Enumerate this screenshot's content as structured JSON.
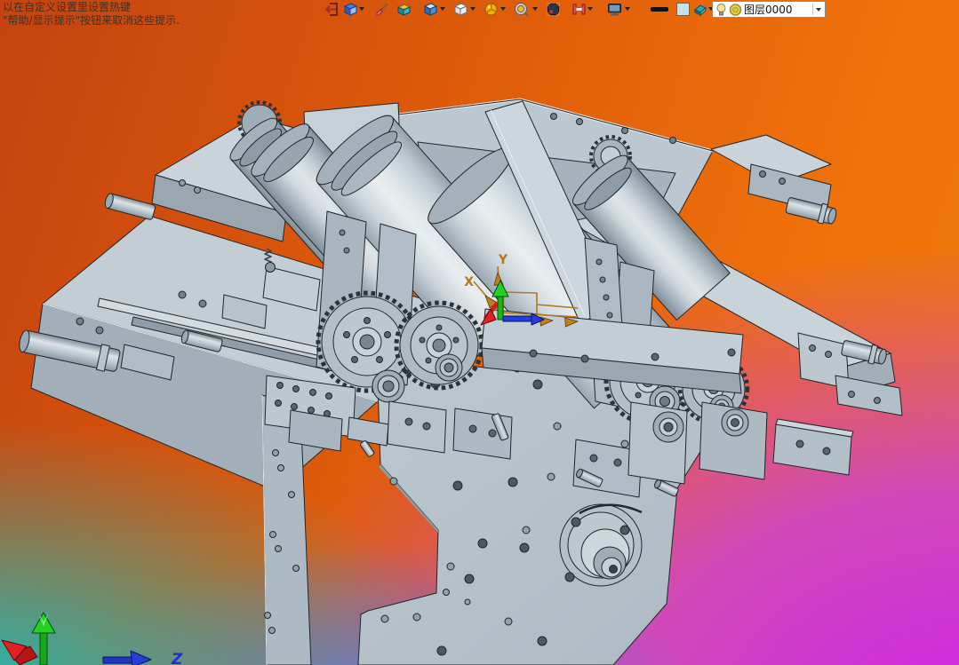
{
  "viewport": {
    "hint_line1": "以在自定义设置里设置热键",
    "hint_line2": "\"帮助/显示提示\"按钮来取消这些提示."
  },
  "toolbar": {
    "items": [
      {
        "name": "exit-icon"
      },
      {
        "name": "component-icon",
        "dropdown": true
      },
      {
        "name": "brush-icon"
      },
      {
        "name": "material-box-icon"
      },
      {
        "name": "cube-blue-icon",
        "dropdown": true
      },
      {
        "name": "cube-white-icon",
        "dropdown": true
      },
      {
        "name": "render-sphere-icon",
        "dropdown": true
      },
      {
        "name": "zoom-preview-icon",
        "dropdown": true
      },
      {
        "name": "capture-frame-icon"
      },
      {
        "name": "endpoint-constraint-icon",
        "dropdown": true
      },
      {
        "name": "display-mode-icon",
        "dropdown": true
      },
      {
        "name": "line-width-icon"
      },
      {
        "name": "color-swatch-icon"
      },
      {
        "name": "eraser-icon",
        "dropdown": true
      }
    ],
    "layer_combo": {
      "value": "图层0000",
      "bulb_icon": "visibility-bulb",
      "ring_icon": "layer-color-ring"
    }
  },
  "axes": {
    "work_x": "X",
    "work_y": "Y",
    "corner_z": "Z"
  },
  "colors": {
    "bg_top_left": "#c44310",
    "bg_top_right": "#f1790a",
    "bg_bottom_left": "#2cb3ab",
    "bg_bottom_center": "#5f74e6",
    "bg_bottom_right": "#ce25e8",
    "machine_light": "#dde4e8",
    "machine_mid": "#b7c2ca",
    "machine_dark": "#8d9ba5",
    "outline": "#20262b",
    "axis_x_red": "#d81c1c",
    "axis_y_green": "#15b815",
    "axis_z_blue": "#2040dd",
    "ucs_orange": "#b5761c"
  }
}
